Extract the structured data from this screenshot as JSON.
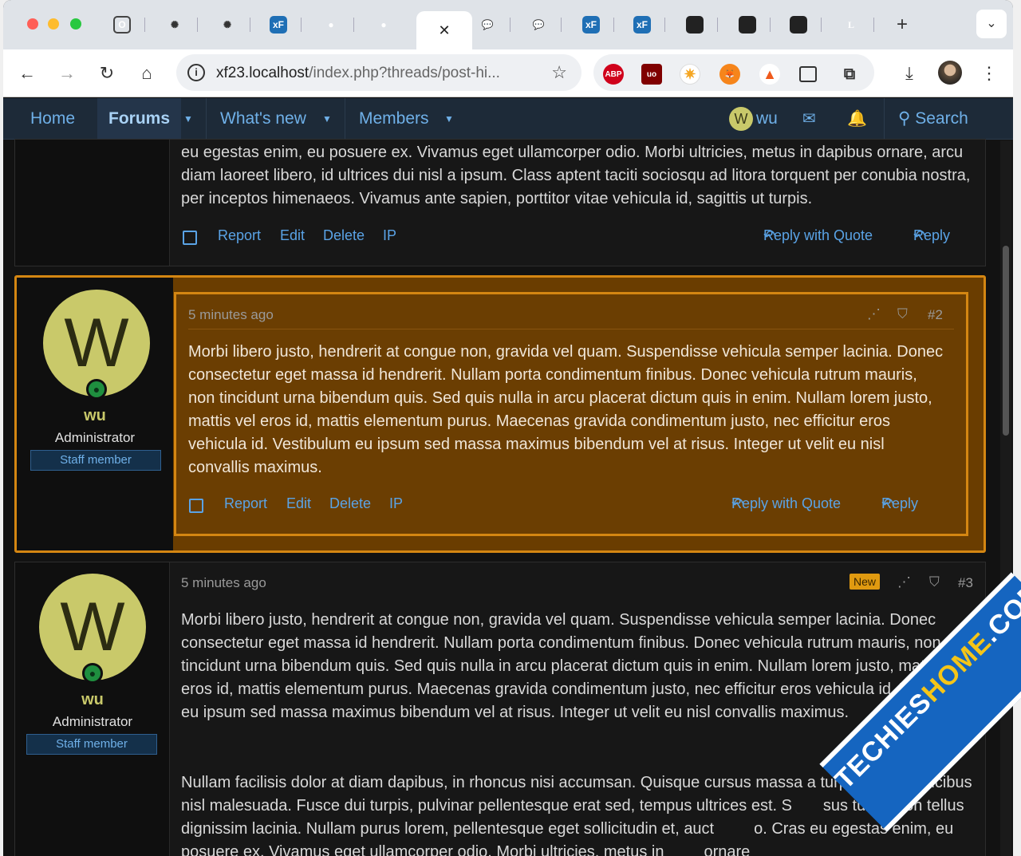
{
  "browser": {
    "url_host": "xf23.localhost",
    "url_path": "/index.php?threads/post-hi...",
    "tabs": [
      {
        "icon": "opera-icon"
      },
      {
        "icon": "openai-icon"
      },
      {
        "icon": "openai-icon"
      },
      {
        "icon": "xenforo-icon",
        "text": "xF"
      },
      {
        "icon": "globe-icon"
      },
      {
        "icon": "globe-icon"
      },
      {
        "icon": "close-icon",
        "active": true
      },
      {
        "icon": "chat-icon"
      },
      {
        "icon": "chat-icon"
      },
      {
        "icon": "xenforo-icon",
        "text": "xF"
      },
      {
        "icon": "xenforo-icon",
        "text": "xF"
      },
      {
        "icon": "mask-icon"
      },
      {
        "icon": "mask-icon"
      },
      {
        "icon": "mask-icon"
      },
      {
        "icon": "letter-l-icon",
        "text": "L"
      }
    ],
    "new_tab_label": "+",
    "extensions": {
      "abp": "ABP",
      "ublock": "uo"
    }
  },
  "nav": {
    "home": "Home",
    "forums": "Forums",
    "whats_new": "What's new",
    "members": "Members",
    "user_initial": "W",
    "user_name": "wu",
    "search": "Search"
  },
  "posts": [
    {
      "body": "eu egestas enim, eu posuere ex. Vivamus eget ullamcorper odio. Morbi ultricies, metus in dapibus ornare, arcu diam laoreet libero, id ultrices dui nisl a ipsum. Class aptent taciti sociosqu ad litora torquent per conubia nostra, per inceptos himenaeos. Vivamus ante sapien, porttitor vitae vehicula id, sagittis ut turpis."
    },
    {
      "time": "5 minutes ago",
      "number": "#2",
      "avatar_letter": "W",
      "user": "wu",
      "user_title": "Administrator",
      "banner": "Staff member",
      "body": "Morbi libero justo, hendrerit at congue non, gravida vel quam. Suspendisse vehicula semper lacinia. Donec consectetur eget massa id hendrerit. Nullam porta condimentum finibus. Donec vehicula rutrum mauris, non tincidunt urna bibendum quis. Sed quis nulla in arcu placerat dictum quis in enim. Nullam lorem justo, mattis vel eros id, mattis elementum purus. Maecenas gravida condimentum justo, nec efficitur eros vehicula id. Vestibulum eu ipsum sed massa maximus bibendum vel at risus. Integer ut velit eu nisl convallis maximus."
    },
    {
      "time": "5 minutes ago",
      "badge": "New",
      "number": "#3",
      "avatar_letter": "W",
      "user": "wu",
      "user_title": "Administrator",
      "banner": "Staff member",
      "body": "Morbi libero justo, hendrerit at congue non, gravida vel quam. Suspendisse vehicula semper lacinia. Donec consectetur eget massa id hendrerit. Nullam porta condimentum finibus. Donec vehicula rutrum mauris, non tincidunt urna bibendum quis. Sed quis nulla in arcu placerat dictum quis in enim. Nullam lorem justo, mattis vel eros id, mattis elementum purus. Maecenas gravida condimentum justo, nec efficitur eros vehicula id. Vestibulum eu ipsum sed massa maximus bibendum vel at risus. Integer ut velit eu nisl convallis maximus.",
      "body2": "Nullam facilisis dolor at diam dapibus, in rhoncus nisi accumsan. Quisque cursus massa a turpis n     et faucibus nisl malesuada. Fusce dui turpis, pulvinar pellentesque erat sed, tempus ultrices est. S       sus turpis non tellus dignissim lacinia. Nullam purus lorem, pellentesque eget sollicitudin et, auct         o. Cras eu egestas enim, eu posuere ex. Vivamus eget ullamcorper odio. Morbi ultricies, metus in         ornare"
    }
  ],
  "actions": {
    "report": "Report",
    "edit": "Edit",
    "delete": "Delete",
    "ip": "IP",
    "reply_quote": "Reply with Quote",
    "reply": "Reply"
  },
  "watermark": {
    "part1": "TECHIES",
    "part2": "HOME",
    "part3": ".COM"
  },
  "colors": {
    "accent": "#5aa3e6",
    "highlight": "#d48612",
    "avatar": "#c9c96a",
    "new_badge": "#e09a10"
  }
}
